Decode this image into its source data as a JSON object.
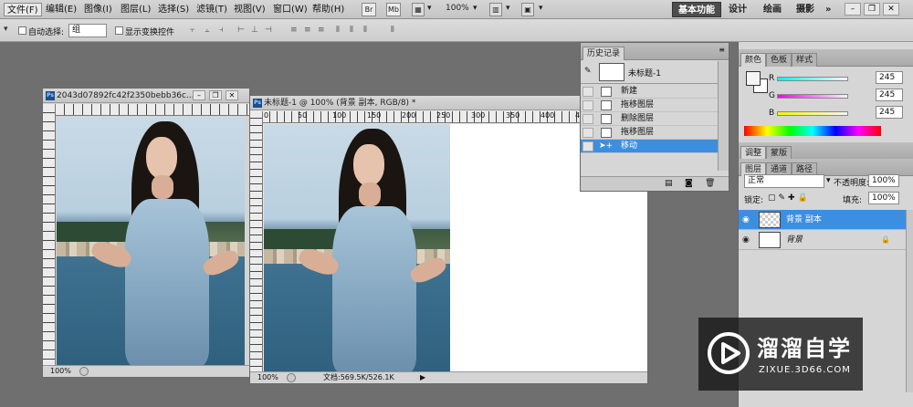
{
  "menubar": {
    "items": [
      "文件(F)",
      "编辑(E)",
      "图像(I)",
      "图层(L)",
      "选择(S)",
      "滤镜(T)",
      "视图(V)",
      "窗口(W)",
      "帮助(H)"
    ],
    "icons": [
      "Br",
      "Mb"
    ],
    "zoom": "100%",
    "workspaces": [
      "基本功能",
      "设计",
      "绘画",
      "摄影"
    ],
    "more": "»"
  },
  "optbar": {
    "auto_select_label": "自动选择:",
    "auto_select_value": "组",
    "show_transform_label": "显示变换控件"
  },
  "doc1": {
    "title": "2043d07892fc42f2350bebb36c...",
    "zoom": "100%"
  },
  "doc2": {
    "title": "未标题-1 @ 100% (背景 副本, RGB/8) *",
    "ruler_h": [
      "0",
      "50",
      "100",
      "150",
      "200",
      "250",
      "300",
      "350",
      "400",
      "450"
    ],
    "ruler_v": [
      "0",
      "5",
      "0",
      "1",
      "0",
      "0",
      "1",
      "5",
      "0",
      "2",
      "0",
      "0",
      "2",
      "5",
      "0"
    ],
    "zoom": "100%",
    "status": "文档:569.5K/526.1K"
  },
  "history": {
    "tab": "历史记录",
    "snapshot": "未标题-1",
    "steps": [
      "新建",
      "拖移图层",
      "删除图层",
      "拖移图层",
      "移动"
    ]
  },
  "color_panel": {
    "tabs": [
      "颜色",
      "色板",
      "样式"
    ],
    "channels": [
      {
        "label": "R",
        "value": "245"
      },
      {
        "label": "G",
        "value": "245"
      },
      {
        "label": "B",
        "value": "245"
      }
    ]
  },
  "adjust_panel": {
    "tabs": [
      "调整",
      "蒙版"
    ]
  },
  "layers_panel": {
    "tabs": [
      "图层",
      "通道",
      "路径"
    ],
    "blend_mode": "正常",
    "opacity_label": "不透明度:",
    "opacity": "100%",
    "lock_label": "锁定:",
    "fill_label": "填充:",
    "fill": "100%",
    "layers": [
      {
        "name": "背景 副本",
        "selected": true
      },
      {
        "name": "背景",
        "selected": false,
        "locked": true
      }
    ]
  },
  "watermark": {
    "title": "溜溜自学",
    "url": "ZIXUE.3D66.COM"
  }
}
